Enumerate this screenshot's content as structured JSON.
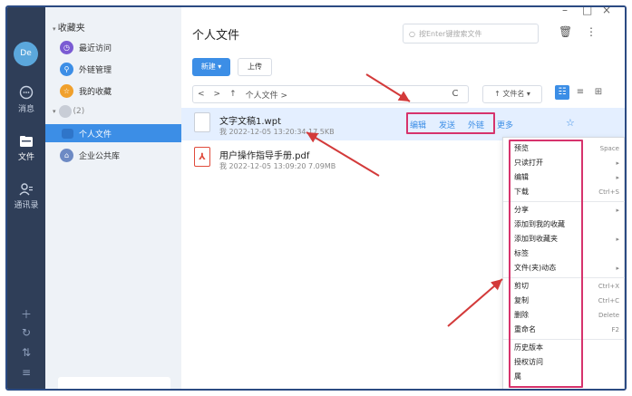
{
  "window": {
    "controls": [
      "–",
      "□",
      "×"
    ]
  },
  "rail": {
    "avatar": "De",
    "items": [
      {
        "label": "消息",
        "icon": "chat-icon"
      },
      {
        "label": "文件",
        "icon": "folder-icon"
      },
      {
        "label": "通讯录",
        "icon": "contacts-icon"
      }
    ],
    "bottom_icons": [
      "＋",
      "↻",
      "⇅",
      "≡"
    ]
  },
  "sidebar": {
    "header": "收藏夹",
    "items": [
      {
        "label": "最近访问",
        "color": "#7a5bd3",
        "glyph": "◷"
      },
      {
        "label": "外链管理",
        "color": "#3c8ee6",
        "glyph": "⚲"
      },
      {
        "label": "我的收藏",
        "color": "#f0a02c",
        "glyph": "☆"
      }
    ],
    "group_label": "(2)",
    "personal": "个人文件",
    "enterprise": "企业公共库"
  },
  "main": {
    "title": "个人文件",
    "search_placeholder": "按Enter键搜索文件",
    "new_button": "新建 ▾",
    "upload_button": "上传",
    "path": "个人文件 >",
    "sort_label": "↑ 文件名 ▾",
    "files": [
      {
        "name": "文字文稿1.wpt",
        "meta": "我  2022-12-05 13:20:34  17.5KB",
        "actions": [
          "编辑",
          "发送",
          "外链",
          "更多"
        ]
      },
      {
        "name": "用户操作指导手册.pdf",
        "meta": "我  2022-12-05 13:09:20  7.09MB"
      }
    ]
  },
  "context_menu": {
    "items": [
      {
        "label": "预览",
        "shortcut": "Space"
      },
      {
        "label": "只读打开",
        "shortcut": "▸"
      },
      {
        "label": "编辑",
        "shortcut": "▸"
      },
      {
        "label": "下载",
        "shortcut": "Ctrl+S"
      },
      {
        "label": "分享",
        "shortcut": "▸"
      },
      {
        "label": "添加到我的收藏",
        "shortcut": ""
      },
      {
        "label": "添加到收藏夹",
        "shortcut": "▸"
      },
      {
        "label": "标签",
        "shortcut": ""
      },
      {
        "label": "文件(夹)动态",
        "shortcut": "▸"
      },
      {
        "label": "剪切",
        "shortcut": "Ctrl+X"
      },
      {
        "label": "复制",
        "shortcut": "Ctrl+C"
      },
      {
        "label": "删除",
        "shortcut": "Delete"
      },
      {
        "label": "重命名",
        "shortcut": "F2"
      },
      {
        "label": "历史版本",
        "shortcut": ""
      },
      {
        "label": "授权访问",
        "shortcut": ""
      },
      {
        "label": "属",
        "shortcut": ""
      }
    ]
  },
  "colors": {
    "accent": "#3c8ee6",
    "highlight": "#d6336c",
    "arrow": "#d33a3a",
    "rail": "#2f3e58"
  }
}
